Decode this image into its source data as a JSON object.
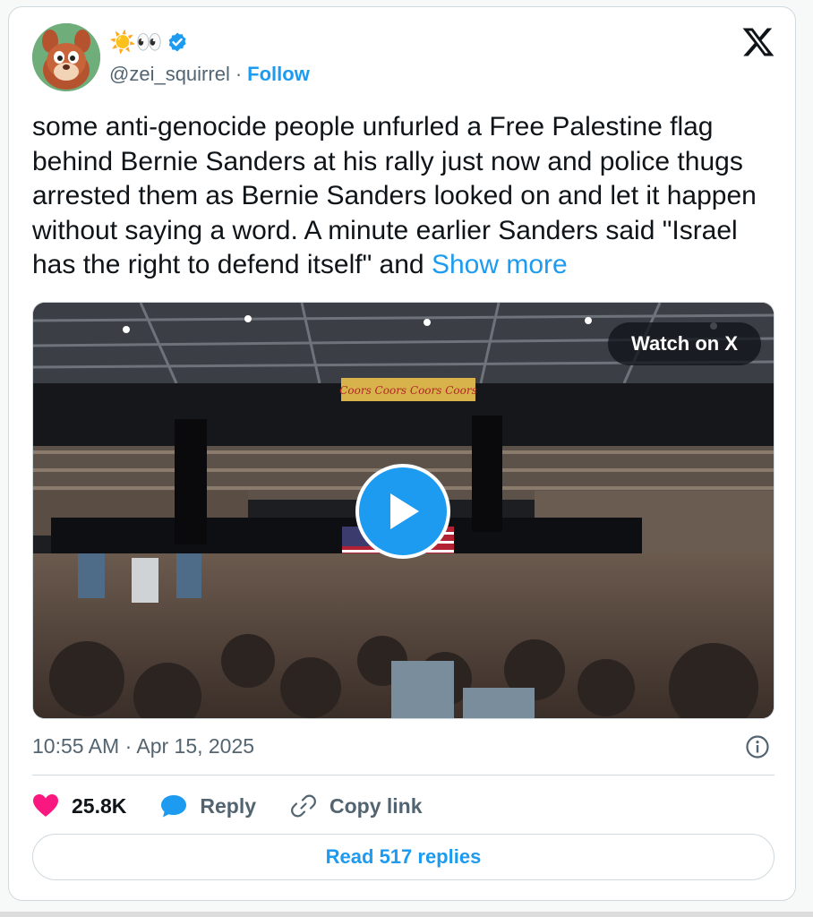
{
  "author": {
    "display_emojis": "☀️👀",
    "verified": true,
    "handle": "@zei_squirrel",
    "separator": "·",
    "follow_label": "Follow"
  },
  "brand": {
    "logo_icon": "x-logo-icon"
  },
  "tweet": {
    "text": "some anti-genocide people unfurled a Free Palestine flag behind Bernie Sanders at his rally just now and police thugs arrested them as Bernie Sanders looked on and let it happen without saying a word. A minute earlier Sanders said \"Israel has the right to defend itself\" and",
    "show_more_label": "Show more"
  },
  "media": {
    "watch_label": "Watch on X",
    "banner_text": "Coors Coors Coors Coors",
    "play_icon": "play-icon"
  },
  "meta": {
    "timestamp": "10:55 AM · Apr 15, 2025",
    "info_icon": "info-icon"
  },
  "actions": {
    "likes": "25.8K",
    "reply_label": "Reply",
    "copy_link_label": "Copy link"
  },
  "read_replies_label": "Read 517 replies",
  "colors": {
    "accent": "#1d9bf0",
    "like": "#f91880",
    "text_primary": "#0f1419",
    "text_secondary": "#536471",
    "border": "#cfd9de"
  }
}
